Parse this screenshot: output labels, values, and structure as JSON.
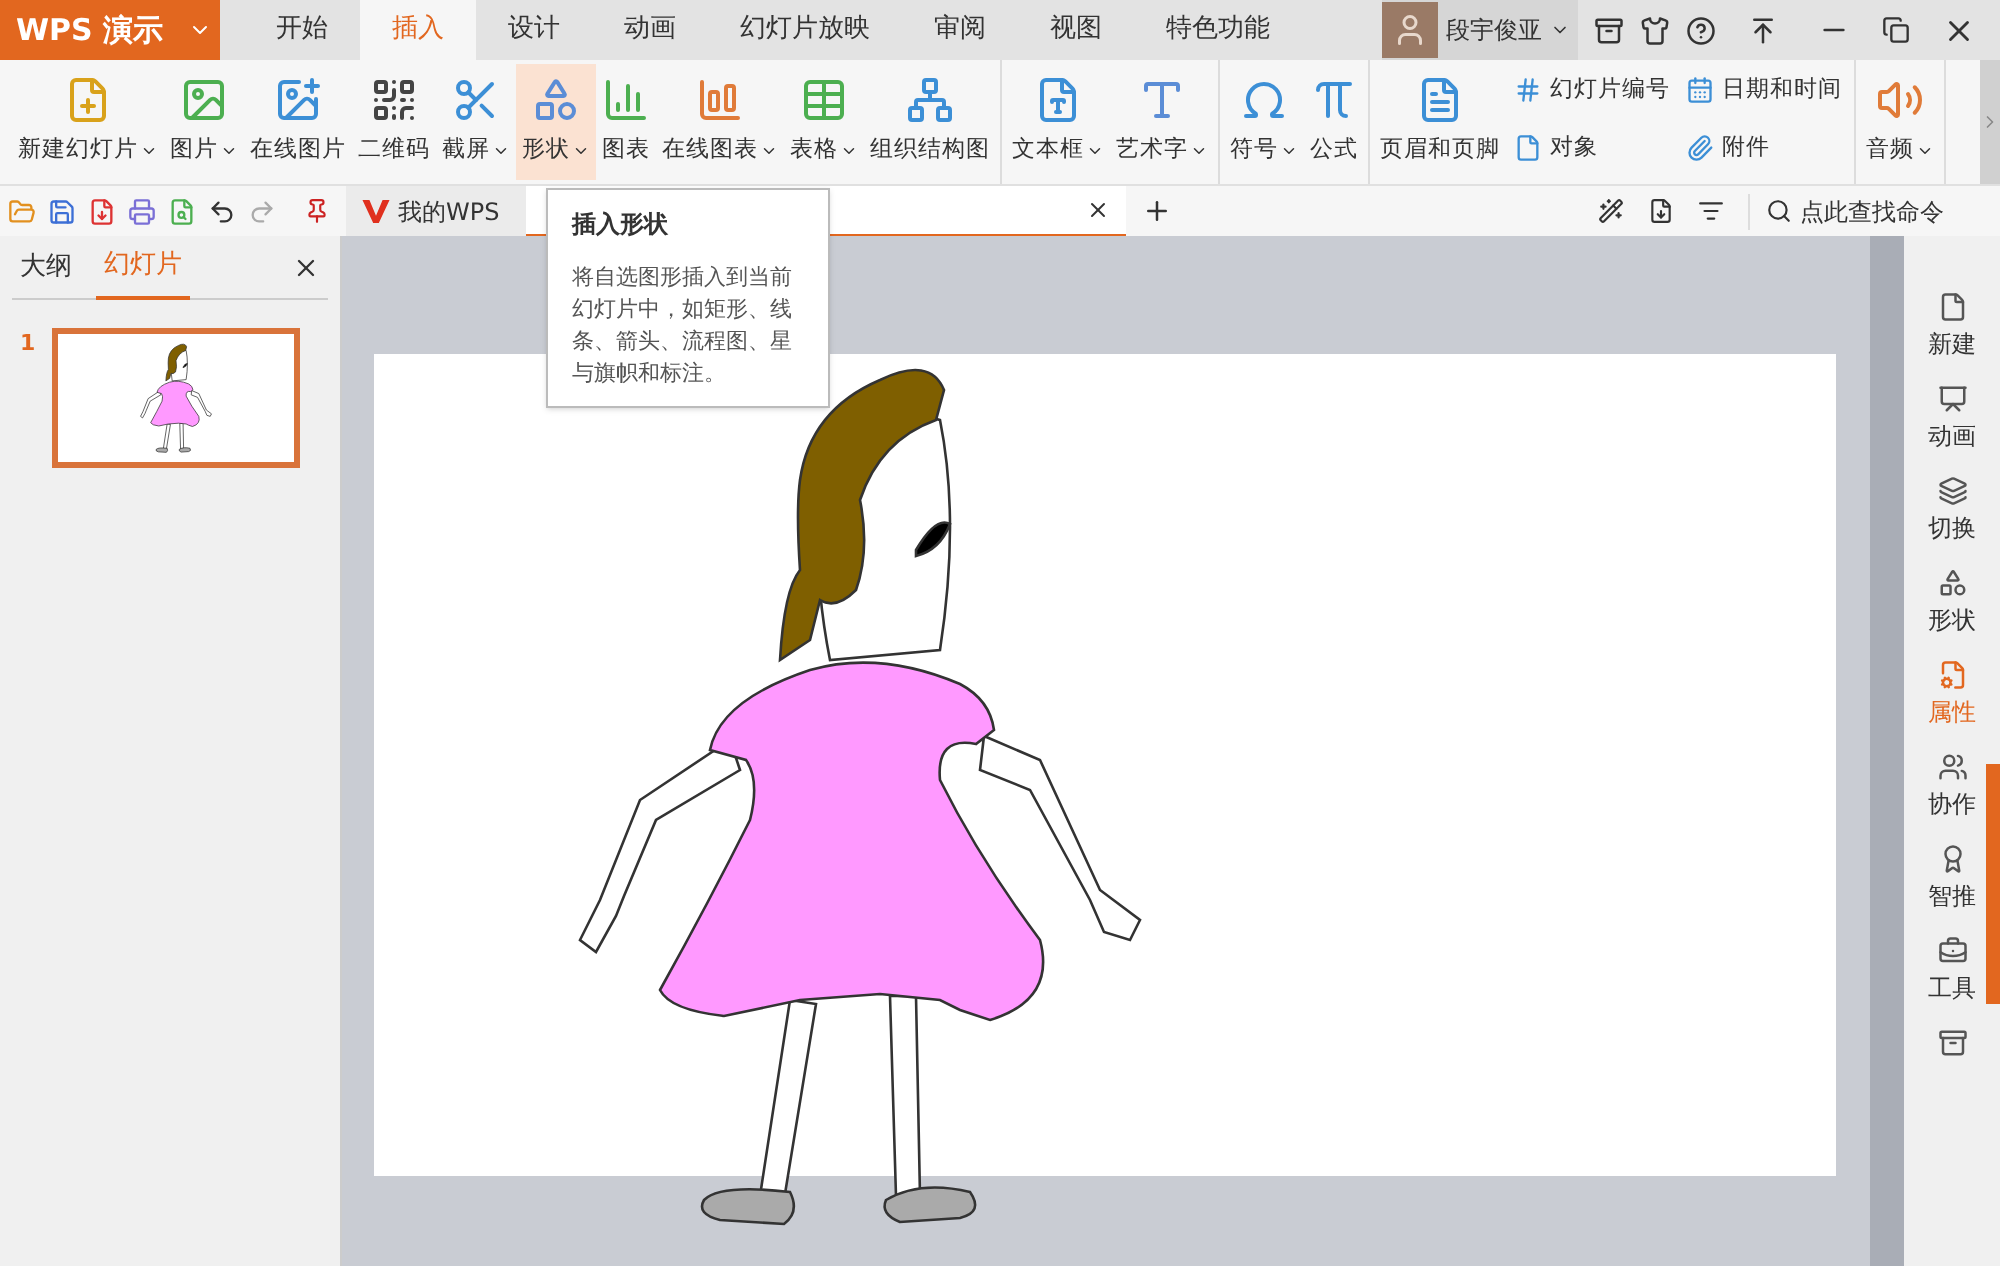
{
  "app": {
    "logo": "WPS 演示"
  },
  "menu_tabs": [
    {
      "label": "开始",
      "selected": false
    },
    {
      "label": "插入",
      "selected": true
    },
    {
      "label": "设计",
      "selected": false
    },
    {
      "label": "动画",
      "selected": false
    },
    {
      "label": "幻灯片放映",
      "selected": false
    },
    {
      "label": "审阅",
      "selected": false
    },
    {
      "label": "视图",
      "selected": false
    },
    {
      "label": "特色功能",
      "selected": false
    }
  ],
  "user": {
    "name": "段宇俊亚"
  },
  "ribbon": {
    "groups": [
      {
        "items": [
          {
            "label": "新建幻灯片",
            "dropdown": true,
            "selected": false
          },
          {
            "label": "图片",
            "dropdown": true,
            "selected": false
          },
          {
            "label": "在线图片",
            "dropdown": false,
            "selected": false
          },
          {
            "label": "二维码",
            "dropdown": false,
            "selected": false
          },
          {
            "label": "截屏",
            "dropdown": true,
            "selected": false
          },
          {
            "label": "形状",
            "dropdown": true,
            "selected": true
          },
          {
            "label": "图表",
            "dropdown": false,
            "selected": false
          },
          {
            "label": "在线图表",
            "dropdown": true,
            "selected": false
          },
          {
            "label": "表格",
            "dropdown": true,
            "selected": false
          },
          {
            "label": "组织结构图",
            "dropdown": false,
            "selected": false
          }
        ]
      },
      {
        "items": [
          {
            "label": "文本框",
            "dropdown": true,
            "selected": false
          },
          {
            "label": "艺术字",
            "dropdown": true,
            "selected": false
          }
        ]
      },
      {
        "items": [
          {
            "label": "符号",
            "dropdown": true,
            "selected": false
          },
          {
            "label": "公式",
            "dropdown": false,
            "selected": false
          }
        ]
      },
      {
        "items": [
          {
            "label": "页眉和页脚",
            "dropdown": false,
            "selected": false
          }
        ],
        "small_items": [
          {
            "label": "幻灯片编号"
          },
          {
            "label": "日期和时间"
          },
          {
            "label": "对象"
          },
          {
            "label": "附件"
          }
        ]
      },
      {
        "items": [
          {
            "label": "音频",
            "dropdown": true,
            "selected": false
          }
        ]
      }
    ]
  },
  "doc_tabs": [
    {
      "label": "我的WPS",
      "selected": false
    },
    {
      "selected": true
    }
  ],
  "search": {
    "placeholder": "点此查找命令"
  },
  "tooltip": {
    "title": "插入形状",
    "text": "将自选图形插入到当前幻灯片中，如矩形、线条、箭头、流程图、星与旗帜和标注。"
  },
  "left_pane": {
    "tabs": [
      {
        "label": "大纲",
        "selected": false
      },
      {
        "label": "幻灯片",
        "selected": true
      }
    ],
    "slides": [
      {
        "number": "1",
        "selected": true
      }
    ]
  },
  "sidebar": {
    "items": [
      {
        "label": "新建",
        "selected": false
      },
      {
        "label": "动画",
        "selected": false
      },
      {
        "label": "切换",
        "selected": false
      },
      {
        "label": "形状",
        "selected": false
      },
      {
        "label": "属性",
        "selected": true
      },
      {
        "label": "协作",
        "selected": false
      },
      {
        "label": "智推",
        "selected": false
      },
      {
        "label": "工具",
        "selected": false
      }
    ]
  }
}
